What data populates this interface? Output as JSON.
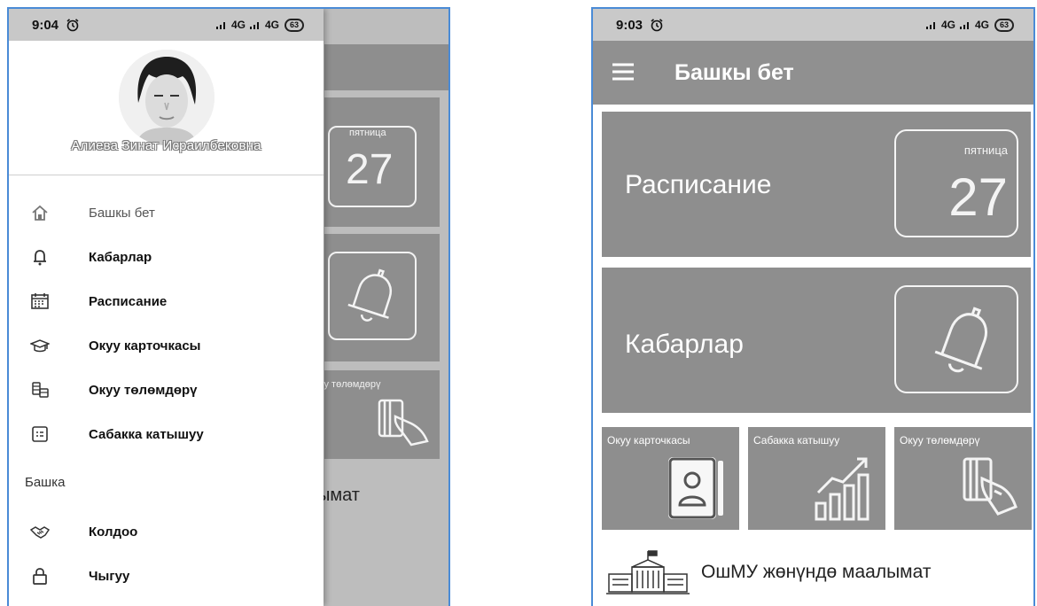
{
  "left": {
    "status": {
      "time": "9:04",
      "network": "4G",
      "network2": "4G",
      "battery": "63"
    },
    "user": {
      "name": "Алиева Зинат Исраилбековна"
    },
    "menu": {
      "items": [
        {
          "label": "Башкы бет",
          "icon": "home-icon"
        },
        {
          "label": "Кабарлар",
          "icon": "bell-icon"
        },
        {
          "label": "Расписание",
          "icon": "calendar-icon"
        },
        {
          "label": "Окуу карточкасы",
          "icon": "graduation-cap-icon"
        },
        {
          "label": "Окуу төлөмдөрү",
          "icon": "coins-icon"
        },
        {
          "label": "Сабакка катышуу",
          "icon": "attendance-icon"
        }
      ],
      "section_label": "Башка",
      "extra": [
        {
          "label": "Колдоо",
          "icon": "handshake-icon"
        },
        {
          "label": "Чыгуу",
          "icon": "lock-icon"
        }
      ]
    },
    "background": {
      "weekday": "пятница",
      "day": "27",
      "pay_label": "уу төлөмдөрү",
      "about_partial": "ымат"
    }
  },
  "right": {
    "status": {
      "time": "9:03",
      "network": "4G",
      "network2": "4G",
      "battery": "63"
    },
    "app_title": "Башкы бет",
    "tiles": {
      "schedule": {
        "label": "Расписание",
        "weekday": "пятница",
        "day": "27"
      },
      "news": {
        "label": "Кабарлар"
      },
      "record": {
        "label": "Окуу карточкасы"
      },
      "attendance": {
        "label": "Сабакка катышуу"
      },
      "payments": {
        "label": "Окуу төлөмдөрү"
      }
    },
    "about": {
      "label": "ОшМУ жөнүндө маалымат"
    }
  },
  "colors": {
    "tile": "#8e8e8e",
    "appbar": "#909090",
    "frame": "#4a8bd6",
    "status": "#c9c9c9"
  }
}
